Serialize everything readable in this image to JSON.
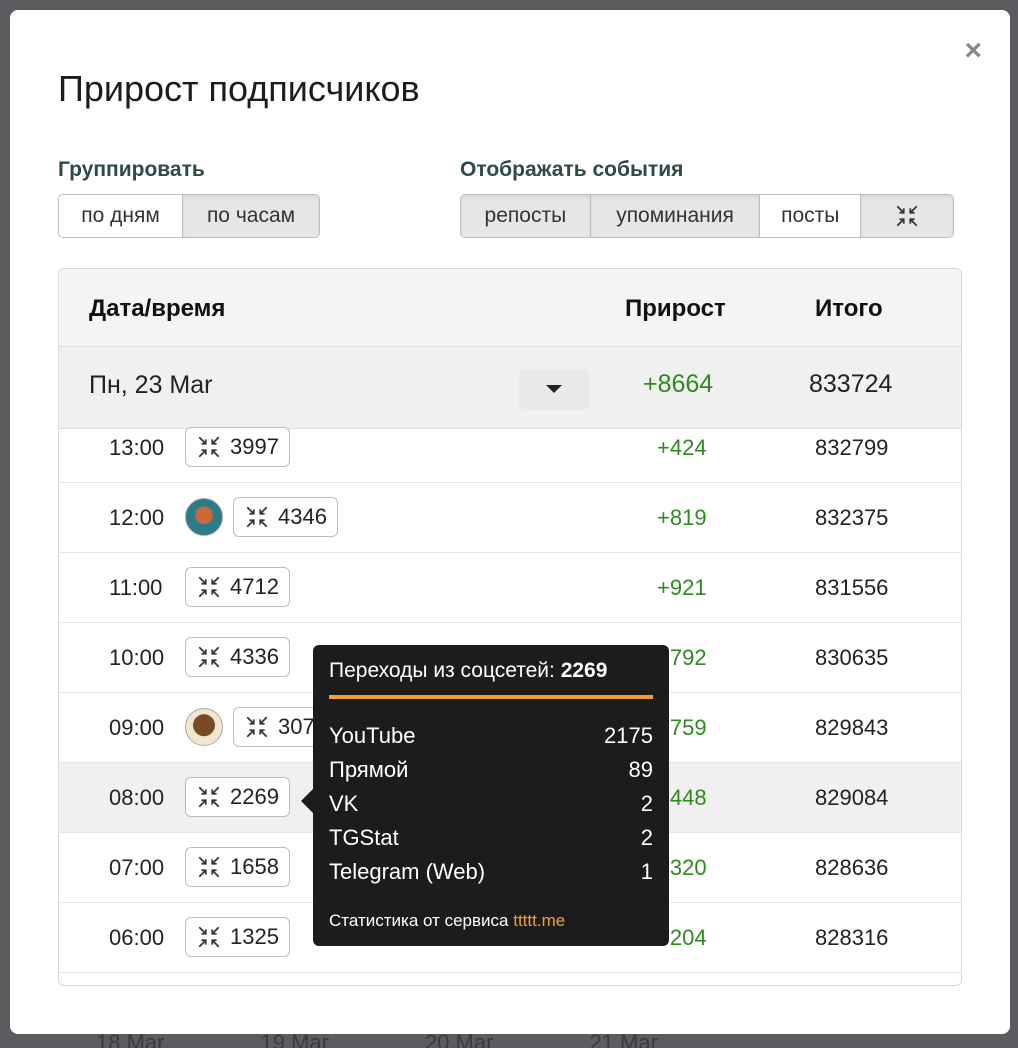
{
  "background": {
    "axis_dates": [
      "18 Mar",
      "19 Mar",
      "20 Mar",
      "21 Mar"
    ]
  },
  "modal": {
    "title": "Прирост подписчиков",
    "close_label": "×",
    "group": {
      "label": "Группировать",
      "options": [
        "по дням",
        "по часам"
      ],
      "selected": "по часам"
    },
    "events": {
      "label": "Отображать события",
      "options": [
        "репосты",
        "упоминания",
        "посты"
      ],
      "active": [
        "репосты",
        "упоминания"
      ],
      "icon_button": "merge-arrows-icon"
    }
  },
  "table": {
    "headers": {
      "date": "Дата/время",
      "growth": "Прирост",
      "total": "Итого"
    },
    "day": {
      "date": "Пн, 23 Mar",
      "growth": "+8664",
      "total": "833724"
    },
    "rows": [
      {
        "time": "13:00",
        "avatar": false,
        "clicks": "3997",
        "growth": "+424",
        "total": "832799"
      },
      {
        "time": "12:00",
        "avatar": "a1",
        "clicks": "4346",
        "growth": "+819",
        "total": "832375"
      },
      {
        "time": "11:00",
        "avatar": false,
        "clicks": "4712",
        "growth": "+921",
        "total": "831556"
      },
      {
        "time": "10:00",
        "avatar": false,
        "clicks": "4336",
        "growth": "+792",
        "total": "830635"
      },
      {
        "time": "09:00",
        "avatar": "a2",
        "clicks": "3078",
        "growth": "+759",
        "total": "829843"
      },
      {
        "time": "08:00",
        "avatar": false,
        "clicks": "2269",
        "growth": "+448",
        "total": "829084"
      },
      {
        "time": "07:00",
        "avatar": false,
        "clicks": "1658",
        "growth": "+320",
        "total": "828636"
      },
      {
        "time": "06:00",
        "avatar": false,
        "clicks": "1325",
        "growth": "+204",
        "total": "828316"
      }
    ],
    "colors": {
      "positive": "#2e8a1f",
      "highlight_row": "#f0f0f0"
    }
  },
  "tooltip": {
    "title_prefix": "Переходы из соцсетей:",
    "title_value": "2269",
    "items": [
      {
        "name": "YouTube",
        "value": "2175"
      },
      {
        "name": "Прямой",
        "value": "89"
      },
      {
        "name": "VK",
        "value": "2"
      },
      {
        "name": "TGStat",
        "value": "2"
      },
      {
        "name": "Telegram (Web)",
        "value": "1"
      }
    ],
    "footer_text": "Статистика от сервиса",
    "footer_link": "ttttt.me",
    "accent": "#f0a030"
  }
}
